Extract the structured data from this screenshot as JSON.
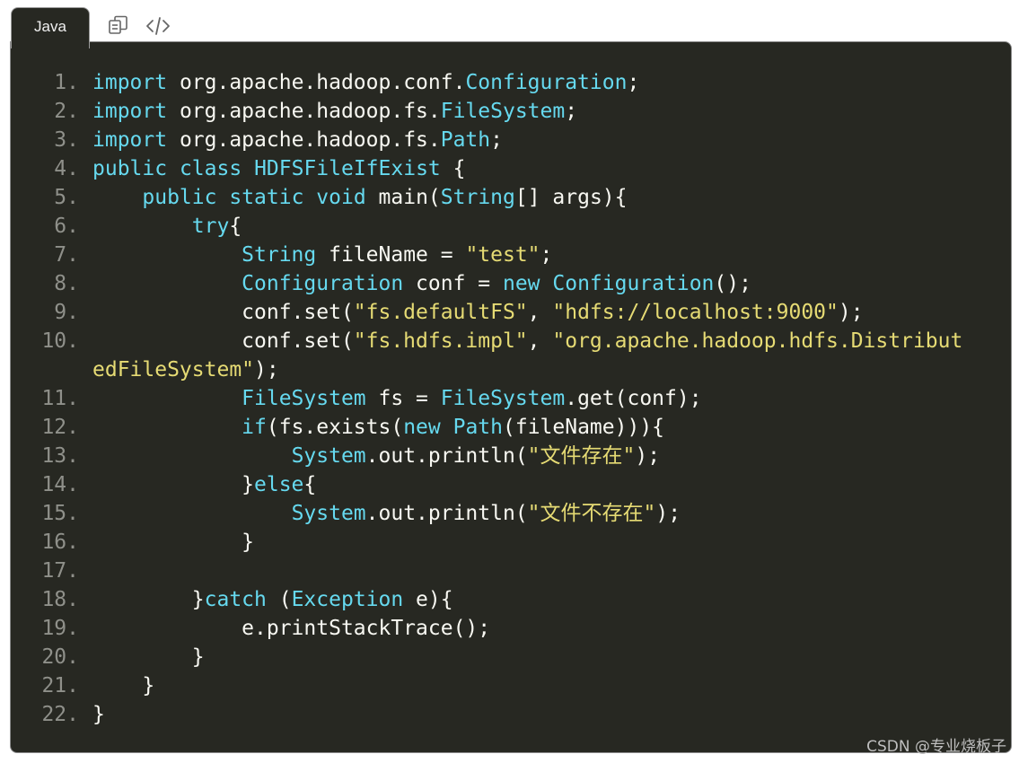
{
  "tab": {
    "label": "Java"
  },
  "toolbar": {
    "copy_icon": "copy-icon",
    "view_source_icon": "code-icon"
  },
  "colors": {
    "background": "#272822",
    "keyword": "#66d9ef",
    "string": "#e6db74",
    "text": "#f8f8f2",
    "line_number": "#8f908a"
  },
  "code_lines": [
    {
      "num": "1.",
      "tokens": [
        [
          "kw",
          "import"
        ],
        [
          "t",
          " org.apache.hadoop.conf."
        ],
        [
          "ty",
          "Configuration"
        ],
        [
          "t",
          ";"
        ]
      ]
    },
    {
      "num": "2.",
      "tokens": [
        [
          "kw",
          "import"
        ],
        [
          "t",
          " org.apache.hadoop.fs."
        ],
        [
          "ty",
          "FileSystem"
        ],
        [
          "t",
          ";"
        ]
      ]
    },
    {
      "num": "3.",
      "tokens": [
        [
          "kw",
          "import"
        ],
        [
          "t",
          " org.apache.hadoop.fs."
        ],
        [
          "ty",
          "Path"
        ],
        [
          "t",
          ";"
        ]
      ]
    },
    {
      "num": "4.",
      "tokens": [
        [
          "kw",
          "public"
        ],
        [
          "t",
          " "
        ],
        [
          "kw",
          "class"
        ],
        [
          "t",
          " "
        ],
        [
          "ty",
          "HDFSFileIfExist"
        ],
        [
          "t",
          " {"
        ]
      ]
    },
    {
      "num": "5.",
      "tokens": [
        [
          "t",
          "    "
        ],
        [
          "kw",
          "public"
        ],
        [
          "t",
          " "
        ],
        [
          "kw",
          "static"
        ],
        [
          "t",
          " "
        ],
        [
          "kw",
          "void"
        ],
        [
          "t",
          " main("
        ],
        [
          "ty",
          "String"
        ],
        [
          "t",
          "[] args){"
        ]
      ]
    },
    {
      "num": "6.",
      "tokens": [
        [
          "t",
          "        "
        ],
        [
          "kw",
          "try"
        ],
        [
          "t",
          "{"
        ]
      ]
    },
    {
      "num": "7.",
      "tokens": [
        [
          "t",
          "            "
        ],
        [
          "ty",
          "String"
        ],
        [
          "t",
          " fileName = "
        ],
        [
          "st",
          "\"test\""
        ],
        [
          "t",
          ";"
        ]
      ]
    },
    {
      "num": "8.",
      "tokens": [
        [
          "t",
          "            "
        ],
        [
          "ty",
          "Configuration"
        ],
        [
          "t",
          " conf = "
        ],
        [
          "kw",
          "new"
        ],
        [
          "t",
          " "
        ],
        [
          "ty",
          "Configuration"
        ],
        [
          "t",
          "();"
        ]
      ]
    },
    {
      "num": "9.",
      "tokens": [
        [
          "t",
          "            conf.set("
        ],
        [
          "st",
          "\"fs.defaultFS\""
        ],
        [
          "t",
          ", "
        ],
        [
          "st",
          "\"hdfs://localhost:9000\""
        ],
        [
          "t",
          ");"
        ]
      ]
    },
    {
      "num": "10.",
      "tokens": [
        [
          "t",
          "            conf.set("
        ],
        [
          "st",
          "\"fs.hdfs.impl\""
        ],
        [
          "t",
          ", "
        ],
        [
          "st",
          "\"org.apache.hadoop.hdfs.Distribut"
        ]
      ]
    },
    {
      "num": "",
      "tokens": [
        [
          "st",
          "edFileSystem\""
        ],
        [
          "t",
          ");"
        ]
      ]
    },
    {
      "num": "11.",
      "tokens": [
        [
          "t",
          "            "
        ],
        [
          "ty",
          "FileSystem"
        ],
        [
          "t",
          " fs = "
        ],
        [
          "ty",
          "FileSystem"
        ],
        [
          "t",
          ".get(conf);"
        ]
      ]
    },
    {
      "num": "12.",
      "tokens": [
        [
          "t",
          "            "
        ],
        [
          "kw",
          "if"
        ],
        [
          "t",
          "(fs.exists("
        ],
        [
          "kw",
          "new"
        ],
        [
          "t",
          " "
        ],
        [
          "ty",
          "Path"
        ],
        [
          "t",
          "(fileName))){"
        ]
      ]
    },
    {
      "num": "13.",
      "tokens": [
        [
          "t",
          "                "
        ],
        [
          "ty",
          "System"
        ],
        [
          "t",
          ".out.println("
        ],
        [
          "st",
          "\"文件存在\""
        ],
        [
          "t",
          ");"
        ]
      ]
    },
    {
      "num": "14.",
      "tokens": [
        [
          "t",
          "            }"
        ],
        [
          "kw",
          "else"
        ],
        [
          "t",
          "{"
        ]
      ]
    },
    {
      "num": "15.",
      "tokens": [
        [
          "t",
          "                "
        ],
        [
          "ty",
          "System"
        ],
        [
          "t",
          ".out.println("
        ],
        [
          "st",
          "\"文件不存在\""
        ],
        [
          "t",
          ");"
        ]
      ]
    },
    {
      "num": "16.",
      "tokens": [
        [
          "t",
          "            }"
        ]
      ]
    },
    {
      "num": "17.",
      "tokens": [
        [
          "t",
          ""
        ]
      ]
    },
    {
      "num": "18.",
      "tokens": [
        [
          "t",
          "        }"
        ],
        [
          "kw",
          "catch"
        ],
        [
          "t",
          " ("
        ],
        [
          "ty",
          "Exception"
        ],
        [
          "t",
          " e){"
        ]
      ]
    },
    {
      "num": "19.",
      "tokens": [
        [
          "t",
          "            e.printStackTrace();"
        ]
      ]
    },
    {
      "num": "20.",
      "tokens": [
        [
          "t",
          "        }"
        ]
      ]
    },
    {
      "num": "21.",
      "tokens": [
        [
          "t",
          "    }"
        ]
      ]
    },
    {
      "num": "22.",
      "tokens": [
        [
          "t",
          "}"
        ]
      ]
    }
  ],
  "watermark": "CSDN @专业烧板子"
}
